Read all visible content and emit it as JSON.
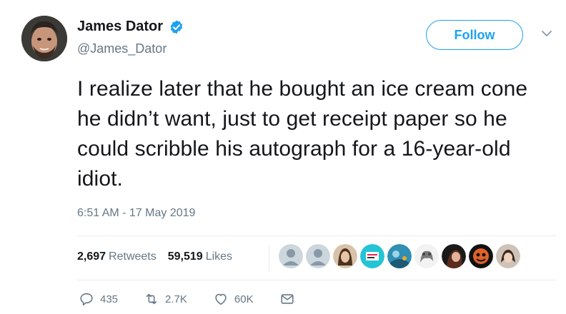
{
  "author": {
    "display_name": "James Dator",
    "handle": "@James_Dator",
    "verified": true,
    "follow_label": "Follow"
  },
  "tweet": {
    "text": "I realize later that he bought an ice cream cone he didn’t want, just to get receipt paper so he could scribble his autograph for a 16-year-old idiot.",
    "timestamp": "6:51 AM - 17 May 2019"
  },
  "stats": {
    "retweets_count": "2,697",
    "retweets_label": "Retweets",
    "likes_count": "59,519",
    "likes_label": "Likes"
  },
  "liker_avatars": [
    {
      "name": "default-avatar-icon"
    },
    {
      "name": "default-avatar-icon"
    },
    {
      "name": "photo-avatar"
    },
    {
      "name": "logo-avatar"
    },
    {
      "name": "illustration-avatar"
    },
    {
      "name": "photo-avatar"
    },
    {
      "name": "photo-avatar"
    },
    {
      "name": "photo-avatar"
    },
    {
      "name": "photo-avatar"
    }
  ],
  "actions": {
    "replies": "435",
    "retweets": "2.7K",
    "likes": "60K"
  },
  "colors": {
    "accent": "#1da1f2",
    "muted": "#657786",
    "text": "#14171a",
    "divider": "#e6ecf0"
  }
}
